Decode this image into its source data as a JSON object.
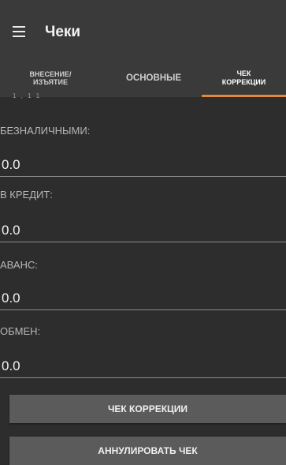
{
  "appbar": {
    "title": "Чеки"
  },
  "tabs": [
    {
      "label": "ВНЕСЕНИЕ/\nИЗЪЯТИЕ"
    },
    {
      "label": "ОСНОВНЫЕ"
    },
    {
      "label": "ЧЕК\nКОРРЕКЦИИ",
      "active": true
    }
  ],
  "scroll_peek": "1 , 1 1",
  "fields": [
    {
      "label": "БЕЗНАЛИЧНЫМИ:",
      "value": "0.0"
    },
    {
      "label": "В КРЕДИТ:",
      "value": "0.0"
    },
    {
      "label": "АВАНС:",
      "value": "0.0"
    },
    {
      "label": "ОБМЕН:",
      "value": "0.0"
    }
  ],
  "buttons": {
    "correction": "ЧЕК КОРРЕКЦИИ",
    "cancel": "АННУЛИРОВАТЬ ЧЕК"
  },
  "colors": {
    "accent": "#e0893a",
    "appbar": "#3a3a3a",
    "background": "#2d2d2d",
    "button": "#5b5b5b"
  },
  "icons": {
    "menu": "hamburger-menu-icon"
  }
}
